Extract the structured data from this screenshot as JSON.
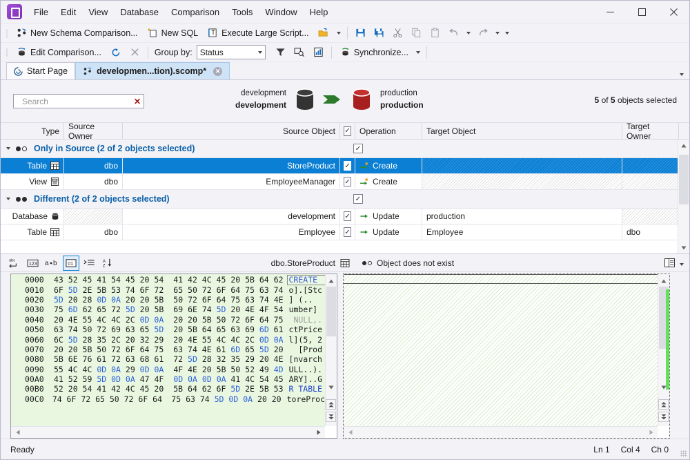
{
  "window": {
    "minimize_label": "─",
    "maximize_label": "□",
    "close_label": "✕"
  },
  "menu": {
    "items": [
      {
        "label": "File"
      },
      {
        "label": "Edit"
      },
      {
        "label": "View"
      },
      {
        "label": "Database"
      },
      {
        "label": "Comparison"
      },
      {
        "label": "Tools"
      },
      {
        "label": "Window"
      },
      {
        "label": "Help"
      }
    ]
  },
  "toolbar1": {
    "new_schema_comparison": "New Schema Comparison...",
    "new_sql": "New SQL",
    "execute_large_script": "Execute Large Script...",
    "icons": [
      "open-folder-icon",
      "save-icon",
      "save-all-icon",
      "cut-icon",
      "copy-icon",
      "paste-icon",
      "undo-icon",
      "redo-icon"
    ]
  },
  "toolbar2": {
    "edit_comparison": "Edit Comparison...",
    "refresh_icon": "refresh-icon",
    "stop_icon": "stop-icon",
    "group_by_label": "Group by:",
    "group_by_value": "Status",
    "filter_icon": "filter-icon",
    "find_icon": "find-object-icon",
    "report_icon": "report-icon",
    "synchronize": "Synchronize..."
  },
  "tabs": [
    {
      "label": "Start Page",
      "icon": "start-page-icon",
      "active": false,
      "closable": false
    },
    {
      "label": "developmen...tion).scomp*",
      "icon": "schema-compare-icon",
      "active": true,
      "closable": true
    }
  ],
  "comparison_header": {
    "search_placeholder": "Search",
    "search_value": "",
    "source": {
      "server": "development",
      "database": "development"
    },
    "target": {
      "server": "production",
      "database": "production"
    },
    "selection_prefix": "",
    "selected_count": "5",
    "total_count": "5",
    "selection_mid": " of ",
    "selection_suffix": " objects selected"
  },
  "grid": {
    "columns": [
      "Type",
      "Source Owner",
      "Source Object",
      "",
      "Operation",
      "Target Object",
      "Target Owner"
    ],
    "header_checkbox_checked": true,
    "groups": [
      {
        "title": "Only in Source (2 of 2 objects selected)",
        "expanded": true,
        "dots": "filled-open",
        "checked": true,
        "rows": [
          {
            "type": "Table",
            "type_icon": "table-icon",
            "source_owner": "dbo",
            "source_object": "StoreProduct",
            "checked": true,
            "operation": "Create",
            "operation_icon": "create-arrow-icon",
            "target_object": "",
            "target_owner": "",
            "selected": true,
            "target_hatched": true
          },
          {
            "type": "View",
            "type_icon": "view-icon",
            "source_owner": "dbo",
            "source_object": "EmployeeManager",
            "checked": true,
            "operation": "Create",
            "operation_icon": "create-arrow-icon",
            "target_object": "",
            "target_owner": "",
            "selected": false,
            "target_hatched": true
          }
        ]
      },
      {
        "title": "Different (2 of 2 objects selected)",
        "expanded": true,
        "dots": "filled-filled",
        "checked": true,
        "rows": [
          {
            "type": "Database",
            "type_icon": "database-icon",
            "source_owner": "",
            "source_object": "development",
            "checked": true,
            "operation": "Update",
            "operation_icon": "update-arrow-icon",
            "target_object": "production",
            "target_owner": "",
            "selected": false,
            "owner_hatched": true
          },
          {
            "type": "Table",
            "type_icon": "table-icon",
            "source_owner": "dbo",
            "source_object": "Employee",
            "checked": true,
            "operation": "Update",
            "operation_icon": "update-arrow-icon",
            "target_object": "Employee",
            "target_owner": "dbo",
            "selected": false
          }
        ]
      }
    ]
  },
  "diff_toolbar": {
    "buttons": [
      {
        "name": "word-wrap-button",
        "label": "abc-wrap-icon",
        "active": false
      },
      {
        "name": "show-line-numbers-button",
        "label": "123-icon",
        "active": false
      },
      {
        "name": "show-whitespace-button",
        "label": "a-dot-b-icon",
        "active": false
      },
      {
        "name": "hex-view-button",
        "label": "hex-01-icon",
        "active": true
      },
      {
        "name": "outline-button",
        "label": "outline-icon",
        "active": false
      },
      {
        "name": "sort-button",
        "label": "sort-az-icon",
        "active": false
      }
    ],
    "left_label": "dbo.StoreProduct",
    "left_icon": "table-icon",
    "right_dots": "filled-open",
    "right_label": "Object does not exist",
    "layout_icon": "split-view-icon",
    "chevron_icon": "chevron-down-icon"
  },
  "hex_view": {
    "rows": [
      {
        "offset": "0000",
        "b1": "43 52 45 41 54 45 20 54",
        "b2": "41 42 4C 45 20 5B 64 62",
        "ascii": "CREATE ",
        "ascii_class": "blu"
      },
      {
        "offset": "0010",
        "b1": "6F 5D 2E 5B 53 74 6F 72",
        "b2": "65 50 72 6F 64 75 63 74",
        "ascii": "o].[Stc"
      },
      {
        "offset": "0020",
        "b1": "5D 20 28 0D 0A 20 20 5B",
        "b2": "50 72 6F 64 75 63 74 4E",
        "ascii": "] (.."
      },
      {
        "offset": "0030",
        "b1": "75 6D 62 65 72 5D 20 5B",
        "b2": "69 6E 74 5D 20 4E 4F 54",
        "ascii": "umber]"
      },
      {
        "offset": "0040",
        "b1": "20 4E 55 4C 4C 2C 0D 0A",
        "b2": "20 20 5B 50 72 6F 64 75",
        "ascii": " NULL,.",
        "ascii_class": "gy"
      },
      {
        "offset": "0050",
        "b1": "63 74 50 72 69 63 65 5D",
        "b2": "20 5B 64 65 63 69 6D 61",
        "ascii": "ctPrice"
      },
      {
        "offset": "0060",
        "b1": "6C 5D 28 35 2C 20 32 29",
        "b2": "20 4E 55 4C 4C 2C 0D 0A",
        "ascii": "l](5, 2"
      },
      {
        "offset": "0070",
        "b1": "20 20 5B 50 72 6F 64 75",
        "b2": "63 74 4E 61 6D 65 5D 20",
        "ascii": "  [Prod"
      },
      {
        "offset": "0080",
        "b1": "5B 6E 76 61 72 63 68 61",
        "b2": "72 5D 28 32 35 29 20 4E",
        "ascii": "[nvarch"
      },
      {
        "offset": "0090",
        "b1": "55 4C 4C 0D 0A 29 0D 0A",
        "b2": "4F 4E 20 5B 50 52 49 4D",
        "ascii": "ULL..)."
      },
      {
        "offset": "00A0",
        "b1": "41 52 59 5D 0D 0A 47 4F",
        "b2": "0D 0A 0D 0A 41 4C 54 45",
        "ascii": "ARY]..G"
      },
      {
        "offset": "00B0",
        "b1": "52 20 54 41 42 4C 45 20",
        "b2": "5B 64 62 6F 5D 2E 5B 53",
        "ascii": "R TABLE",
        "ascii_class": "blu2"
      },
      {
        "offset": "00C0",
        "b1": "74 6F 72 65 50 72 6F 64",
        "b2": "75 63 74 5D 0D 0A 20 20",
        "ascii": "toreProc"
      }
    ]
  },
  "status_bar": {
    "message": "Ready",
    "line": "Ln 1",
    "column": "Col 4",
    "char": "Ch 0"
  },
  "colors": {
    "accent_blue": "#0b7fd4",
    "group_title": "#0a5fa8",
    "hex_background": "#e9f7e0",
    "marker_green": "#62e258",
    "source_db": "#3a3a3a",
    "target_db": "#a81f1f",
    "arrow_green": "#2d7a2d"
  }
}
